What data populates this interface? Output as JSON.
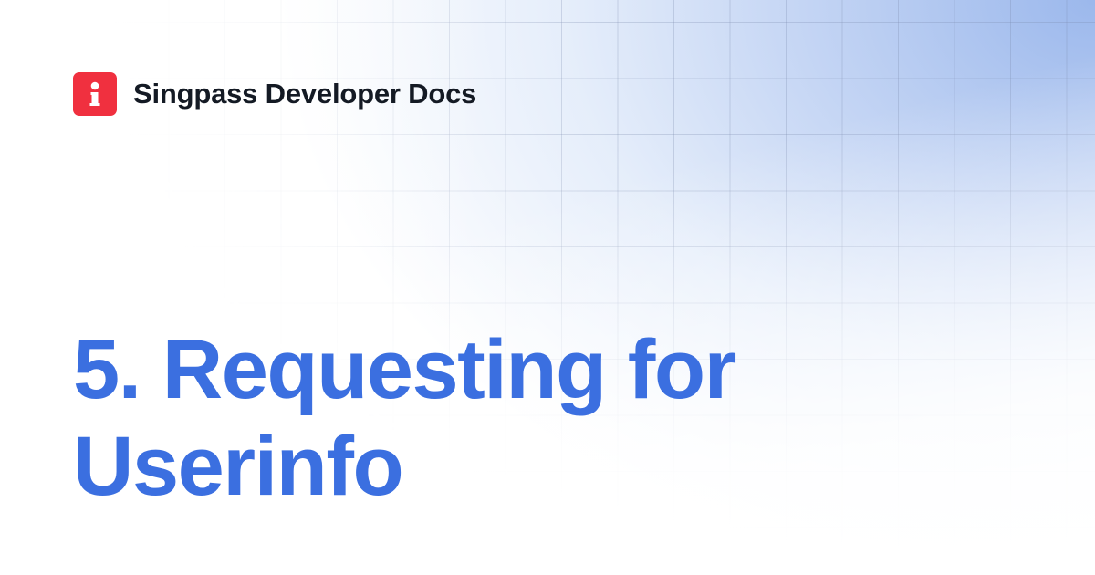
{
  "brand": {
    "name": "Singpass Developer Docs",
    "logo_icon": "singpass-logo-icon",
    "logo_color": "#f0303f"
  },
  "page": {
    "title_lines": [
      "5. Requesting for",
      "Userinfo"
    ],
    "title_color": "#3b6fe0",
    "background_accent": "#9db8ee"
  }
}
